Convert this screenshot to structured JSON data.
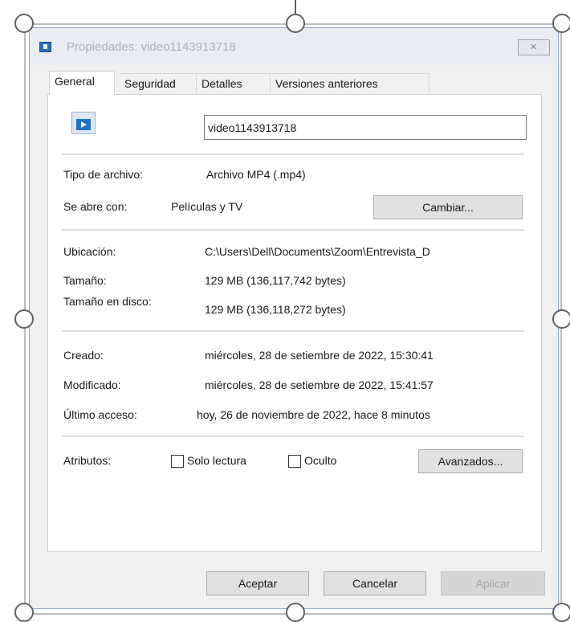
{
  "window": {
    "title": "Propiedades: video1143913718",
    "close_glyph": "✕"
  },
  "tabs": [
    {
      "label": "General",
      "active": true
    },
    {
      "label": "Seguridad",
      "active": false
    },
    {
      "label": "Detalles",
      "active": false
    },
    {
      "label": "Versiones anteriores",
      "active": false
    }
  ],
  "file": {
    "icon": "video-file-icon",
    "name": "video1143913718"
  },
  "type_section": {
    "tipo_label": "Tipo de archivo:",
    "tipo_value": "Archivo MP4 (.mp4)",
    "abre_label": "Se abre con:",
    "abre_value": "Películas y TV",
    "change_button": "Cambiar..."
  },
  "location_section": {
    "ubicacion_label": "Ubicación:",
    "ubicacion_value": "C:\\Users\\Dell\\Documents\\Zoom\\Entrevista_D",
    "tamano_label": "Tamaño:",
    "tamano_value": "129 MB (136,117,742 bytes)",
    "tamano_disco_label": "Tamaño en disco:",
    "tamano_disco_value": "129 MB (136,118,272 bytes)"
  },
  "dates_section": {
    "creado_label": "Creado:",
    "creado_value": "miércoles, 28 de setiembre de 2022, 15:30:41",
    "modificado_label": "Modificado:",
    "modificado_value": "miércoles, 28 de setiembre de 2022, 15:41:57",
    "acceso_label": "Último acceso:",
    "acceso_value": "hoy, 26 de noviembre de 2022, hace 8 minutos"
  },
  "attributes": {
    "label": "Atributos:",
    "readonly_label": "Solo lectura",
    "readonly_checked": false,
    "hidden_label": "Oculto",
    "hidden_checked": false,
    "advanced_button": "Avanzados..."
  },
  "footer": {
    "ok_button": "Aceptar",
    "cancel_button": "Cancelar",
    "apply_button": "Aplicar",
    "apply_enabled": false
  }
}
